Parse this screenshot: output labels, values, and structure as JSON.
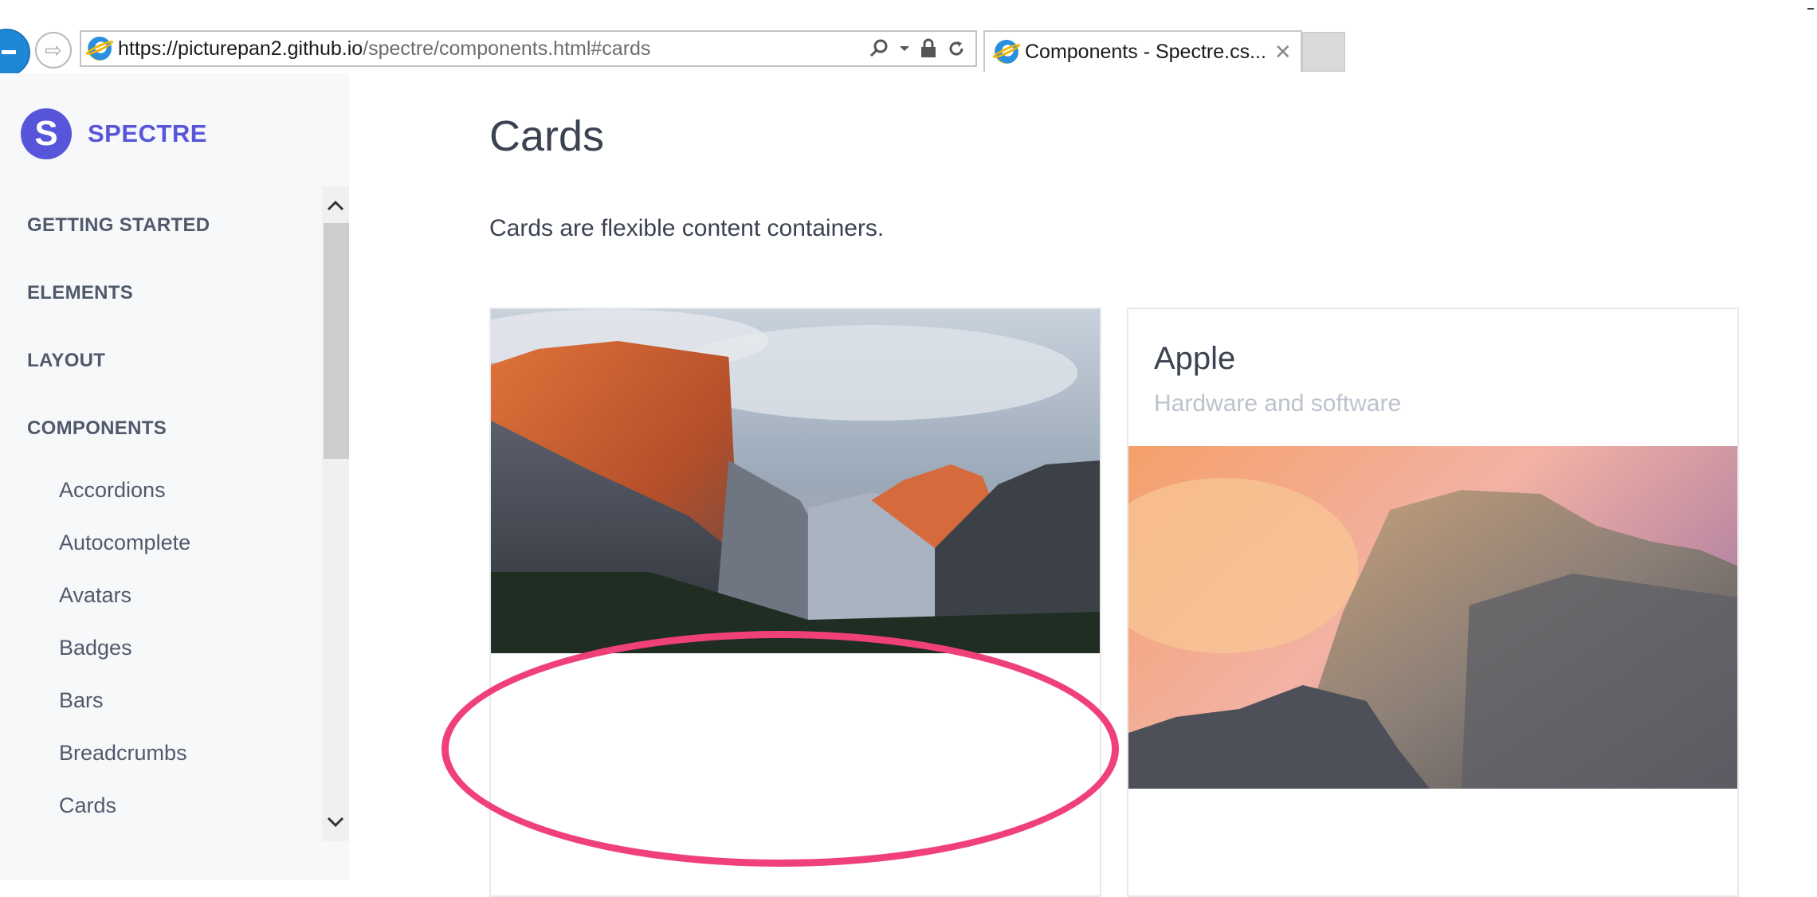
{
  "browser": {
    "url_host": "https://picturepan2.github.io",
    "url_path": "/spectre/components.html#cards",
    "tab_title": "Components - Spectre.cs...",
    "tab_close": "✕",
    "forward_glyph": "⇨"
  },
  "sidebar": {
    "brand_logo": "S",
    "brand_name": "SPECTRE",
    "sections": [
      "GETTING STARTED",
      "ELEMENTS",
      "LAYOUT",
      "COMPONENTS"
    ],
    "items": [
      "Accordions",
      "Autocomplete",
      "Avatars",
      "Badges",
      "Bars",
      "Breadcrumbs",
      "Cards"
    ]
  },
  "main": {
    "title": "Cards",
    "description": "Cards are flexible content containers."
  },
  "cards": [
    {
      "image": "el-capitan-mountain-photo"
    },
    {
      "title": "Apple",
      "subtitle": "Hardware and software",
      "image": "yosemite-half-dome-photo"
    }
  ],
  "colors": {
    "brand": "#5755d9",
    "annotation": "#f0407a",
    "sidebar_bg": "#f7f8f9"
  }
}
